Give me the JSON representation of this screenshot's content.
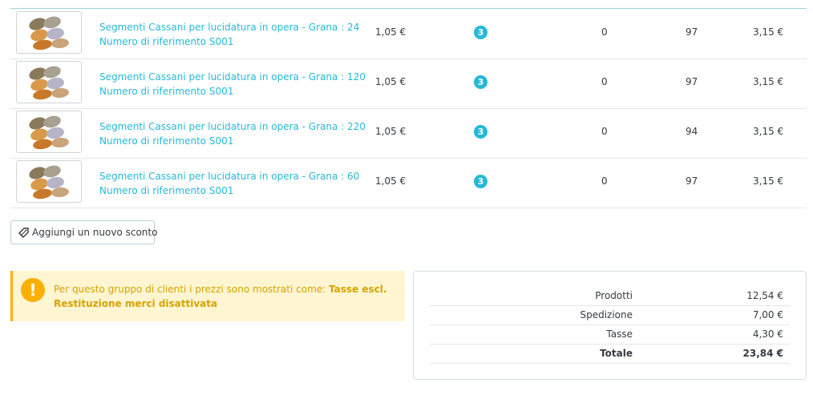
{
  "products": [
    {
      "name": "Segmenti Cassani per lucidatura in opera - Grana : 24",
      "reference": "Numero di riferimento S001",
      "unit_price": "1,05 €",
      "quantity": "3",
      "returned": "0",
      "stock": "97",
      "total": "3,15 €"
    },
    {
      "name": "Segmenti Cassani per lucidatura in opera - Grana : 120",
      "reference": "Numero di riferimento S001",
      "unit_price": "1,05 €",
      "quantity": "3",
      "returned": "0",
      "stock": "97",
      "total": "3,15 €"
    },
    {
      "name": "Segmenti Cassani per lucidatura in opera - Grana : 220",
      "reference": "Numero di riferimento S001",
      "unit_price": "1,05 €",
      "quantity": "3",
      "returned": "0",
      "stock": "94",
      "total": "3,15 €"
    },
    {
      "name": "Segmenti Cassani per lucidatura in opera - Grana : 60",
      "reference": "Numero di riferimento S001",
      "unit_price": "1,05 €",
      "quantity": "3",
      "returned": "0",
      "stock": "97",
      "total": "3,15 €"
    }
  ],
  "add_discount": {
    "label": "Aggiungi un nuovo sconto",
    "icon": "tag-icon"
  },
  "alert": {
    "icon": "warning-icon",
    "text_prefix": "Per questo gruppo di clienti i prezzi sono mostrati come: ",
    "text_bold": "Tasse escl.",
    "line2": "Restituzione merci disattivata"
  },
  "summary": {
    "products_label": "Prodotti",
    "products_value": "12,54 €",
    "shipping_label": "Spedizione",
    "shipping_value": "7,00 €",
    "taxes_label": "Tasse",
    "taxes_value": "4,30 €",
    "total_label": "Totale",
    "total_value": "23,84 €"
  },
  "colors": {
    "link": "#25b9d7",
    "badge": "#25b9d7",
    "warning": "#fab000",
    "warning_bg": "#fff5d1"
  }
}
